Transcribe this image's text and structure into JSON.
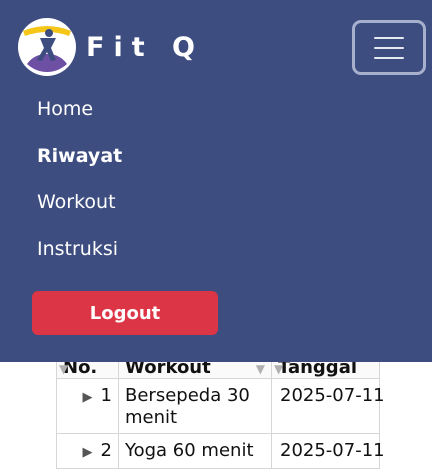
{
  "brand": {
    "name": "Fit Q",
    "logo_icon": "yoga-pose-logo-icon"
  },
  "navbar": {
    "toggler_icon": "hamburger-menu-icon",
    "items": [
      {
        "label": "Home",
        "active": false
      },
      {
        "label": "Riwayat",
        "active": true
      },
      {
        "label": "Workout",
        "active": false
      },
      {
        "label": "Instruksi",
        "active": false
      }
    ],
    "logout_label": "Logout"
  },
  "table": {
    "headers": {
      "no": "No.",
      "workout": "Workout",
      "date": "Tanggal"
    },
    "rows": [
      {
        "no": "1",
        "workout": "Bersepeda 30 menit",
        "date": "2025-07-11"
      },
      {
        "no": "2",
        "workout": "Yoga 60 menit",
        "date": "2025-07-11"
      }
    ]
  },
  "colors": {
    "navbar_bg": "#3d4d80",
    "logout_bg": "#dc3545",
    "logo_yellow": "#f5c518",
    "logo_purple": "#6d4fa3"
  }
}
